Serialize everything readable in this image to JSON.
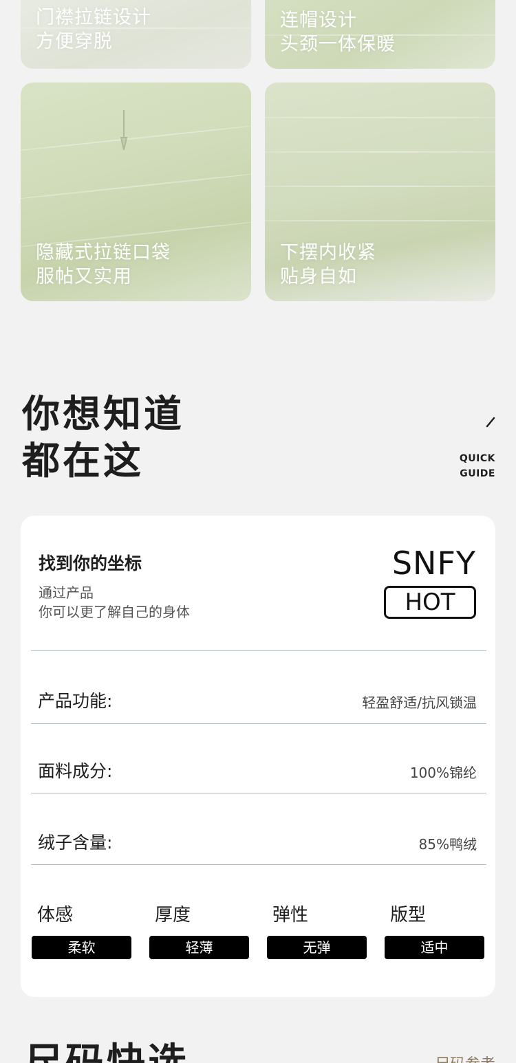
{
  "features": [
    {
      "line1": "门襟拉链设计",
      "line2": "方便穿脱"
    },
    {
      "line1": "连帽设计",
      "line2": "头颈一体保暖"
    },
    {
      "line1": "隐藏式拉链口袋",
      "line2": "服帖又实用"
    },
    {
      "line1": "下摆内收紧",
      "line2": "贴身自如"
    }
  ],
  "quick_section": {
    "title_line1": "你想知道",
    "title_line2": "都在这",
    "guide_line1": "QUICK",
    "guide_line2": "GUIDE"
  },
  "card": {
    "heading": "找到你的坐标",
    "sub_line1": "通过产品",
    "sub_line2": "你可以更了解自己的身体",
    "brand": "SNFY",
    "badge": "HOT",
    "specs": [
      {
        "label": "产品功能:",
        "value": "轻盈舒适/抗风锁温"
      },
      {
        "label": "面料成分:",
        "value": "100%锦纶"
      },
      {
        "label": "绒子含量:",
        "value": "85%鸭绒"
      }
    ],
    "attributes": [
      {
        "name": "体感",
        "value": "柔软"
      },
      {
        "name": "厚度",
        "value": "轻薄"
      },
      {
        "name": "弹性",
        "value": "无弹"
      },
      {
        "name": "版型",
        "value": "适中"
      }
    ]
  },
  "size_section": {
    "title": "尺码快选",
    "ref_link": "尺码参考"
  },
  "colors": {
    "page_bg": "#f2f2f2",
    "jacket_green": "#cfdbb8",
    "pill_bg": "#000000",
    "divider": "#a9bcc6",
    "ref_link": "#8a7b5f"
  }
}
